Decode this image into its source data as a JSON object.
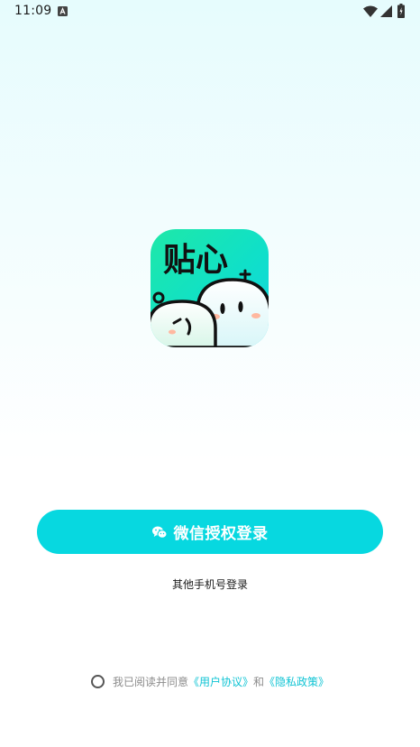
{
  "status_bar": {
    "time": "11:09"
  },
  "logo": {
    "text": "贴心"
  },
  "login": {
    "wechat_label": "微信授权登录",
    "other_label": "其他手机号登录"
  },
  "agreement": {
    "prefix": "我已阅读并同意",
    "user_agreement": "《用户协议》",
    "and": "和",
    "privacy_policy": "《隐私政策》"
  },
  "colors": {
    "accent": "#07d8e0",
    "link": "#10c4d4"
  }
}
